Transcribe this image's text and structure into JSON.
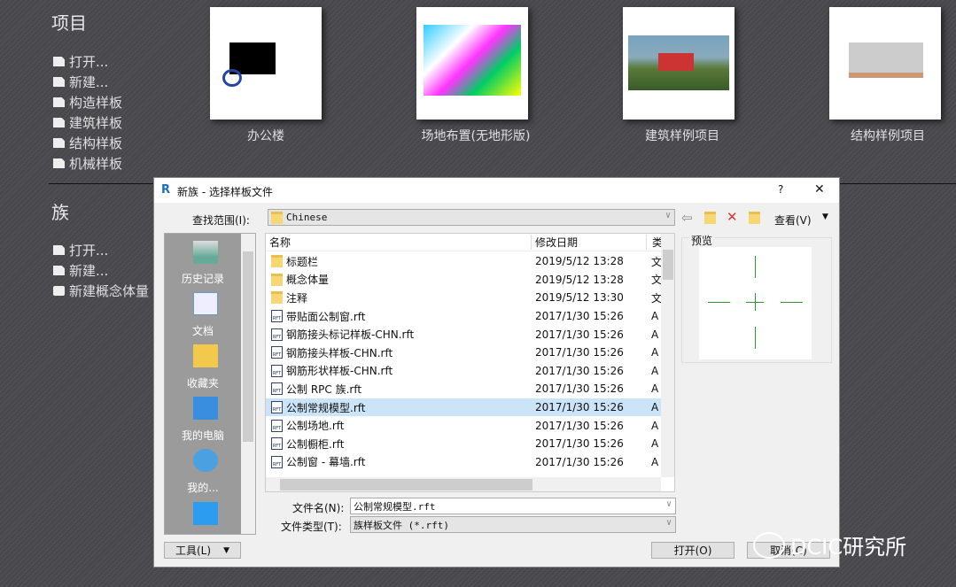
{
  "project": {
    "heading": "项目",
    "links": [
      "打开...",
      "新建...",
      "构造样板",
      "建筑样板",
      "结构样板",
      "机械样板"
    ],
    "thumbnails": [
      "办公楼",
      "场地布置(无地形版)",
      "建筑样例项目",
      "结构样例项目"
    ]
  },
  "family": {
    "heading": "族",
    "links": [
      "打开...",
      "新建...",
      "新建概念体量"
    ]
  },
  "dialog": {
    "title": "新族 - 选择样板文件",
    "help": "?",
    "close": "✕",
    "lookin_label": "查找范围(I):",
    "lookin_value": "Chinese",
    "view_label": "查看(V)",
    "places": [
      "历史记录",
      "文档",
      "收藏夹",
      "我的电脑",
      "我的..."
    ],
    "columns": {
      "name": "名称",
      "date": "修改日期",
      "type": "类"
    },
    "files": [
      {
        "name": "标题栏",
        "date": "2019/5/12 13:28",
        "type": "文",
        "kind": "folder"
      },
      {
        "name": "概念体量",
        "date": "2019/5/12 13:28",
        "type": "文",
        "kind": "folder"
      },
      {
        "name": "注释",
        "date": "2019/5/12 13:30",
        "type": "文",
        "kind": "folder"
      },
      {
        "name": "带贴面公制窗.rft",
        "date": "2017/1/30 15:26",
        "type": "A",
        "kind": "rft"
      },
      {
        "name": "钢筋接头标记样板-CHN.rft",
        "date": "2017/1/30 15:26",
        "type": "A",
        "kind": "rft"
      },
      {
        "name": "钢筋接头样板-CHN.rft",
        "date": "2017/1/30 15:26",
        "type": "A",
        "kind": "rft"
      },
      {
        "name": "钢筋形状样板-CHN.rft",
        "date": "2017/1/30 15:26",
        "type": "A",
        "kind": "rft"
      },
      {
        "name": "公制 RPC 族.rft",
        "date": "2017/1/30 15:26",
        "type": "A",
        "kind": "rft"
      },
      {
        "name": "公制常规模型.rft",
        "date": "2017/1/30 15:26",
        "type": "A",
        "kind": "rft",
        "selected": true
      },
      {
        "name": "公制场地.rft",
        "date": "2017/1/30 15:26",
        "type": "A",
        "kind": "rft"
      },
      {
        "name": "公制橱柜.rft",
        "date": "2017/1/30 15:26",
        "type": "A",
        "kind": "rft"
      },
      {
        "name": "公制窗 - 幕墙.rft",
        "date": "2017/1/30 15:26",
        "type": "A",
        "kind": "rft"
      }
    ],
    "preview_label": "预览",
    "filename_label": "文件名(N):",
    "filename_value": "公制常规模型.rft",
    "filetype_label": "文件类型(T):",
    "filetype_value": "族样板文件 (*.rft)",
    "tools_label": "工具(L)",
    "open_label": "打开(O)",
    "cancel_label": "取消(C)"
  },
  "watermark": "DCIC研究所"
}
